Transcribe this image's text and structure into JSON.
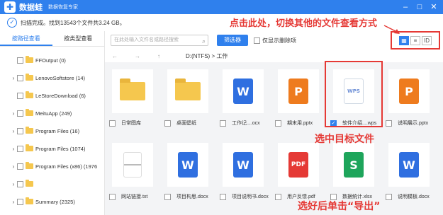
{
  "app": {
    "logo_glyph": "✚",
    "name": "数据蛙",
    "slogan": "数据恢复专家",
    "window_buttons": [
      "–",
      "□",
      "✕"
    ]
  },
  "status": {
    "text": "扫描完成。找到13543个文件共3.24 GB。"
  },
  "sidebar": {
    "tabs": [
      {
        "label": "按路径查看",
        "active": true
      },
      {
        "label": "按类型查看",
        "active": false
      }
    ],
    "items": [
      {
        "label": "FFOutput (0)",
        "expandable": false
      },
      {
        "label": "LenovoSoftstore (14)",
        "expandable": true
      },
      {
        "label": "LeStoreDownload (6)",
        "expandable": false
      },
      {
        "label": "MeituApp (249)",
        "expandable": true
      },
      {
        "label": "Program Files (16)",
        "expandable": true
      },
      {
        "label": "Program Files (1074)",
        "expandable": true
      },
      {
        "label": "Program Files (x86) (1976",
        "expandable": true
      },
      {
        "label": "",
        "expandable": true
      },
      {
        "label": "Summary (2325)",
        "expandable": true
      },
      {
        "label": "",
        "expandable": true
      }
    ]
  },
  "toolbar": {
    "search_placeholder": "在此处输入文件名或路径搜索",
    "search_icon": "⌕",
    "filter_label": "筛选器",
    "deleted_only_label": "仅显示删除项"
  },
  "view_modes": [
    {
      "name": "grid-view",
      "glyph": "▦",
      "active": true
    },
    {
      "name": "list-view",
      "glyph": "≡",
      "active": false
    },
    {
      "name": "detail-view",
      "glyph": "ID",
      "active": false
    }
  ],
  "pathbar": {
    "back": "←",
    "forward": "→",
    "up": "↑",
    "path": "D:(NTFS) > 工作"
  },
  "files": [
    {
      "name": "日常图库",
      "type": "folder",
      "glyph": "",
      "checked": false
    },
    {
      "name": "桌面壁纸",
      "type": "folder",
      "glyph": "",
      "checked": false
    },
    {
      "name": "工作记....ocx",
      "type": "w",
      "glyph": "W",
      "checked": false
    },
    {
      "name": "期末用.pptx",
      "type": "p",
      "glyph": "P",
      "checked": false
    },
    {
      "name": "软件介绍....wps",
      "type": "wps",
      "glyph": "WPS",
      "checked": true
    },
    {
      "name": "说明展示.pptx",
      "type": "p",
      "glyph": "P",
      "checked": false
    },
    {
      "name": "网站链接.txt",
      "type": "txt",
      "glyph": "",
      "checked": false
    },
    {
      "name": "项目构思.docx",
      "type": "w",
      "glyph": "W",
      "checked": false
    },
    {
      "name": "项目说明书.docx",
      "type": "w",
      "glyph": "W",
      "checked": false
    },
    {
      "name": "用户反馈.pdf",
      "type": "pdf",
      "glyph": "PDF",
      "checked": false
    },
    {
      "name": "数据统计.xlsx",
      "type": "s",
      "glyph": "S",
      "checked": false
    },
    {
      "name": "说明模板.docx",
      "type": "w",
      "glyph": "W",
      "checked": false
    }
  ],
  "annotations": {
    "top": "点击此处，切换其他的文件查看方式",
    "middle": "选中目标文件",
    "bottom": "选好后单击“导出”"
  },
  "colors": {
    "accent": "#2f80ed",
    "annotation": "#e53935",
    "folder": "#f5c74e"
  }
}
